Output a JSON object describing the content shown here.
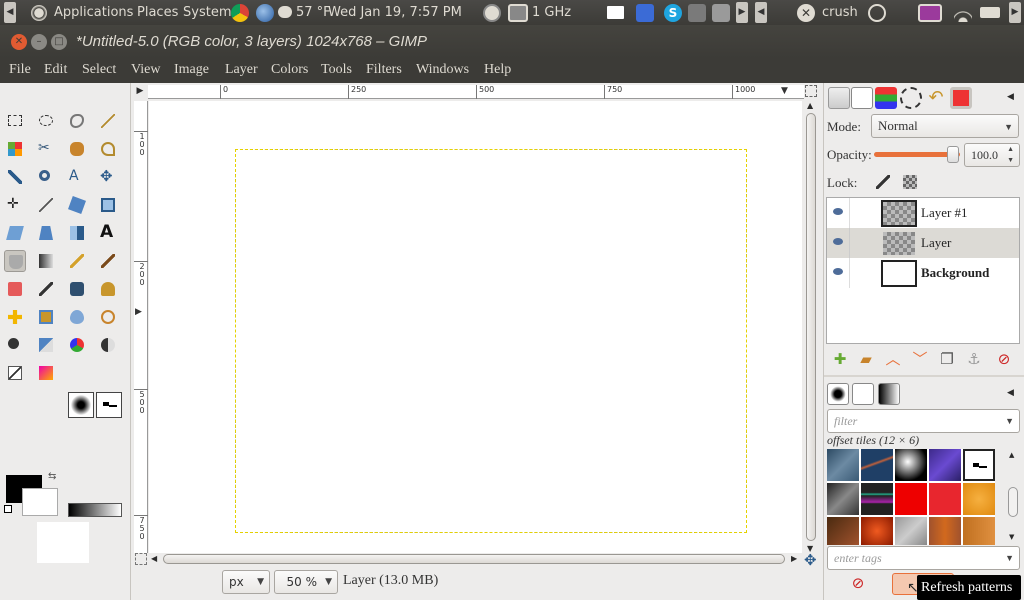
{
  "panel": {
    "applications": "Applications",
    "places": "Places",
    "system": "System",
    "weather": "57 °F",
    "clock": "Wed Jan 19,  7:57 PM",
    "cpu": "1 GHz",
    "user": "crush"
  },
  "window": {
    "title": "*Untitled-5.0 (RGB color, 3 layers) 1024x768 – GIMP"
  },
  "menu": [
    "File",
    "Edit",
    "Select",
    "View",
    "Image",
    "Layer",
    "Colors",
    "Tools",
    "Filters",
    "Windows",
    "Help"
  ],
  "rulers": {
    "top": [
      "0",
      "250",
      "500",
      "750",
      "1000"
    ],
    "left": [
      [
        "1",
        "0",
        "0"
      ],
      [
        "2",
        "0",
        "0"
      ],
      [
        "5",
        "0",
        "0"
      ],
      [
        "7",
        "5",
        "0"
      ]
    ]
  },
  "status": {
    "unit": "px",
    "zoom": "50 %",
    "layer_info": "Layer (13.0 MB)"
  },
  "layers_panel": {
    "mode_label": "Mode:",
    "mode_value": "Normal",
    "opacity_label": "Opacity:",
    "opacity_value": "100.0",
    "opacity_level": 1.0,
    "lock_label": "Lock:",
    "layers": [
      {
        "name": "Layer #1",
        "thumb": "transparent",
        "selected": false
      },
      {
        "name": "Layer",
        "thumb": "transparent",
        "selected": true
      },
      {
        "name": "Background",
        "thumb": "white",
        "selected": false
      }
    ]
  },
  "patterns_panel": {
    "filter_placeholder": "filter",
    "caption": "offset tiles (12 × 6)",
    "tags_placeholder": "enter tags",
    "tooltip": "Refresh patterns"
  },
  "colors": {
    "panel_bg": "#3c3b37",
    "window_bg": "#edeceb",
    "close_button": "#e15b32",
    "selection_accent": "#e5d200",
    "opacity_slider": "#e8713b"
  }
}
